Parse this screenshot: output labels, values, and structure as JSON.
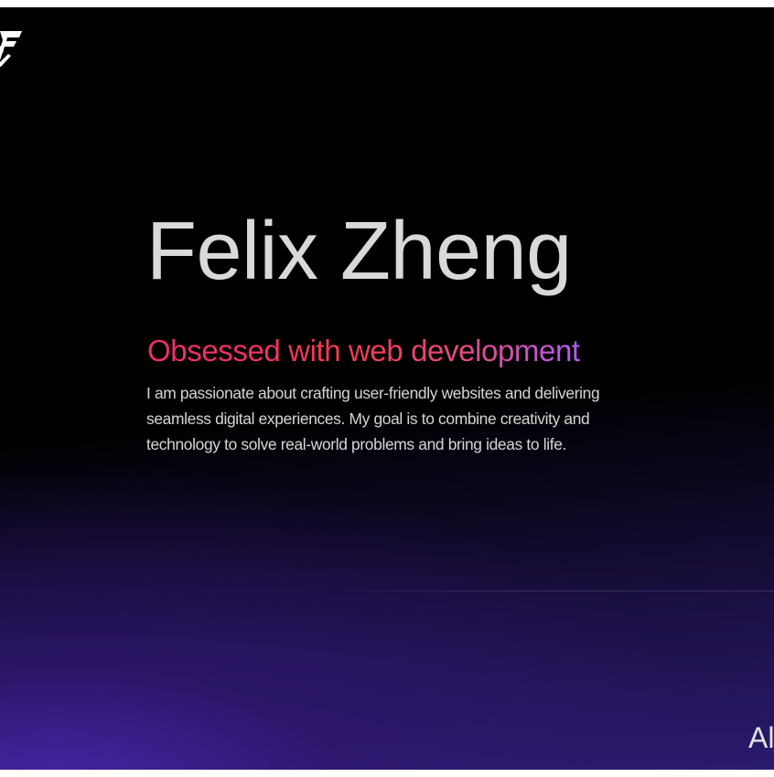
{
  "logo": {
    "icon": "stylized-f-monogram",
    "color": "#ffffff"
  },
  "hero": {
    "name": "Felix Zheng",
    "tagline": "Obsessed with web development",
    "bio": "I am passionate about crafting user-friendly websites and delivering seamless digital experiences. My goal is to combine creativity and technology to solve real-world problems and bring ideas to life."
  },
  "nav": {
    "partial_label": "Al"
  },
  "colors": {
    "background": "#000000",
    "gradient_purple": "#2b1a6e",
    "tagline_start": "#ee2d72",
    "tagline_mid": "#f23a4e",
    "tagline_end": "#b45bf4",
    "text": "#d9d9d9"
  }
}
